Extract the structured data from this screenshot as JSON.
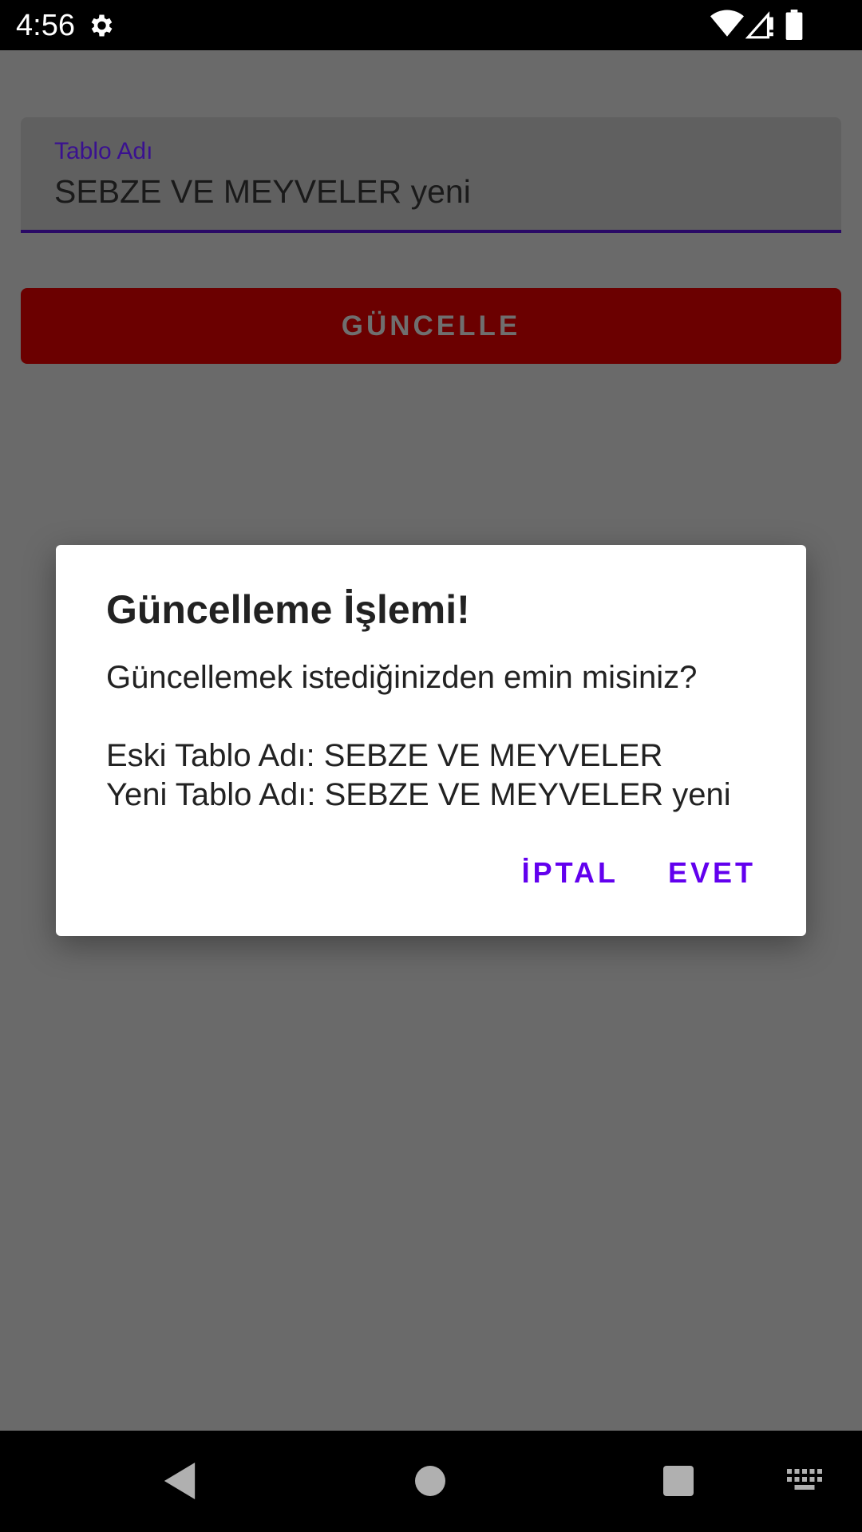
{
  "status_bar": {
    "time": "4:56",
    "icons": [
      "gear-icon",
      "wifi-icon",
      "signal-icon",
      "battery-icon"
    ]
  },
  "form": {
    "field_label": "Tablo Adı",
    "field_value": "SEBZE VE MEYVELER yeni",
    "update_button": "GÜNCELLE"
  },
  "dialog": {
    "title": "Güncelleme İşlemi!",
    "message": "Güncellemek istediğinizden emin misiniz?\n\nEski Tablo Adı: SEBZE VE MEYVELER\nYeni Tablo Adı: SEBZE VE MEYVELER yeni",
    "cancel_label": "İPTAL",
    "confirm_label": "EVET"
  },
  "nav_bar": {
    "icons": [
      "back-icon",
      "home-icon",
      "recents-icon",
      "keyboard-icon"
    ]
  },
  "colors": {
    "accent": "#6200ee",
    "button_bg": "#6b0000",
    "scrim": "#6a6a6a"
  }
}
